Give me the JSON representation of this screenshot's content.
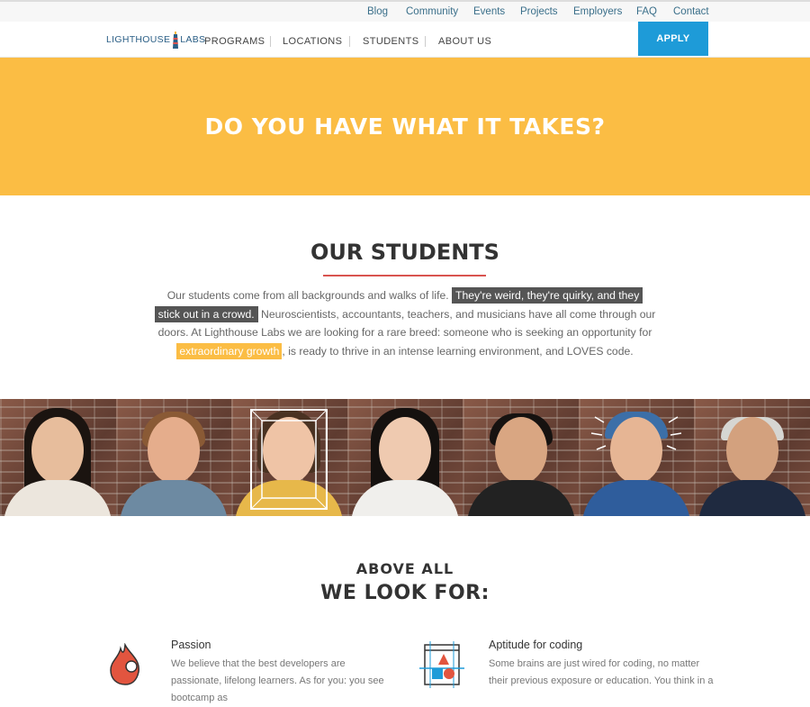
{
  "topbar": {
    "links": [
      "Blog",
      "Community",
      "Events",
      "Projects",
      "Employers",
      "FAQ",
      "Contact"
    ]
  },
  "nav": {
    "logo_text_left": "LIGHTHOUSE",
    "logo_text_right": "LABS",
    "items": [
      "PROGRAMS",
      "LOCATIONS",
      "STUDENTS",
      "ABOUT US"
    ],
    "apply_label": "APPLY"
  },
  "hero": {
    "heading": "DO YOU HAVE WHAT IT TAKES?"
  },
  "students": {
    "heading": "OUR STUDENTS",
    "text_1": "Our students come from all backgrounds and walks of life.",
    "highlight_1a": "They're weird, they're quirky, and they",
    "highlight_1b": "stick out in a crowd.",
    "text_2": " Neuroscientists, accountants, teachers, and musicians have all come through our doors. At Lighthouse Labs we are looking for a rare breed: someone who is seeking an opportunity for ",
    "highlight_2": "extraordinary growth",
    "text_3": ", is ready to thrive in an intense learning environment, and LOVES code."
  },
  "lookfor": {
    "kicker": "ABOVE ALL",
    "heading": "WE LOOK FOR:",
    "features": [
      {
        "title": "Passion",
        "icon": "flame-icon",
        "text": "We believe that the best developers are passionate, lifelong learners. As for you: you see bootcamp as"
      },
      {
        "title": "Aptitude for coding",
        "icon": "shapes-window-icon",
        "text": "Some brains are just wired for coding, no matter their previous exposure or education. You think in a"
      }
    ]
  },
  "colors": {
    "accent_yellow": "#fbbd44",
    "apply_blue": "#1e9bd8",
    "underline_red": "#d9534f"
  }
}
